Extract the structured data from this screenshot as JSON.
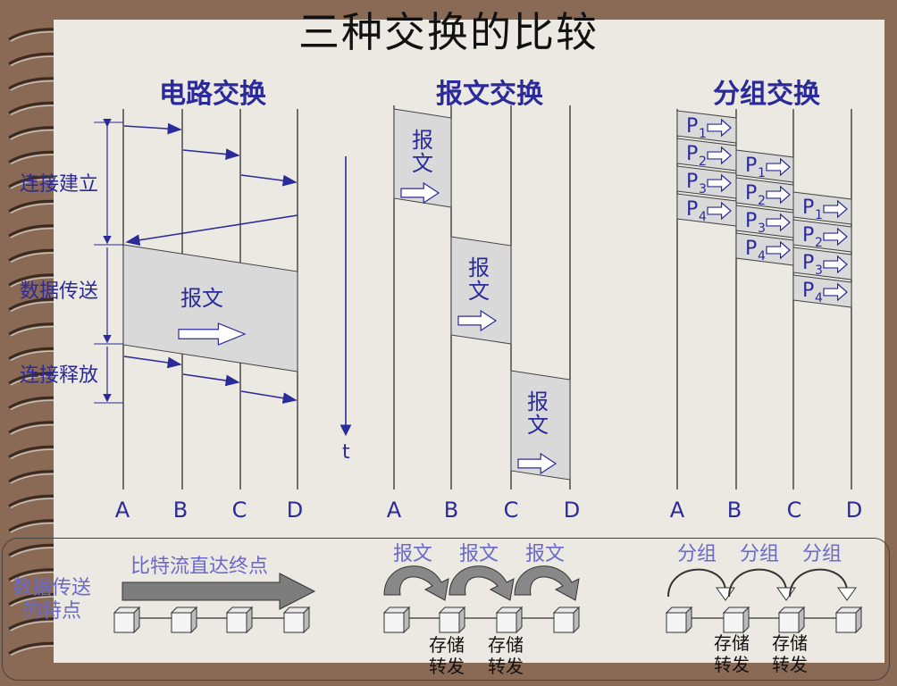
{
  "title": "三种交换的比较",
  "sections": {
    "circuit": "电路交换",
    "message": "报文交换",
    "packet": "分组交换"
  },
  "phases": {
    "setup": "连接建立",
    "transfer": "数据传送",
    "release": "连接释放"
  },
  "nodes": [
    "A",
    "B",
    "C",
    "D"
  ],
  "time_label": "t",
  "message_label": "报文",
  "message_label_vertical": [
    "报",
    "文"
  ],
  "packet_labels": [
    "P1",
    "P2",
    "P3",
    "P4"
  ],
  "bottom": {
    "feature_label_line1": "数据传送",
    "feature_label_line2": "的特点",
    "circuit_desc": "比特流直达终点",
    "message_hop_labels": [
      "报文",
      "报文",
      "报文"
    ],
    "packet_hop_labels": [
      "分组",
      "分组",
      "分组"
    ],
    "store_forward_line1": "存储",
    "store_forward_line2": "转发"
  },
  "colors": {
    "accent": "#2a2a9a",
    "paper": "#ece8e2",
    "background": "#8a6a55"
  }
}
